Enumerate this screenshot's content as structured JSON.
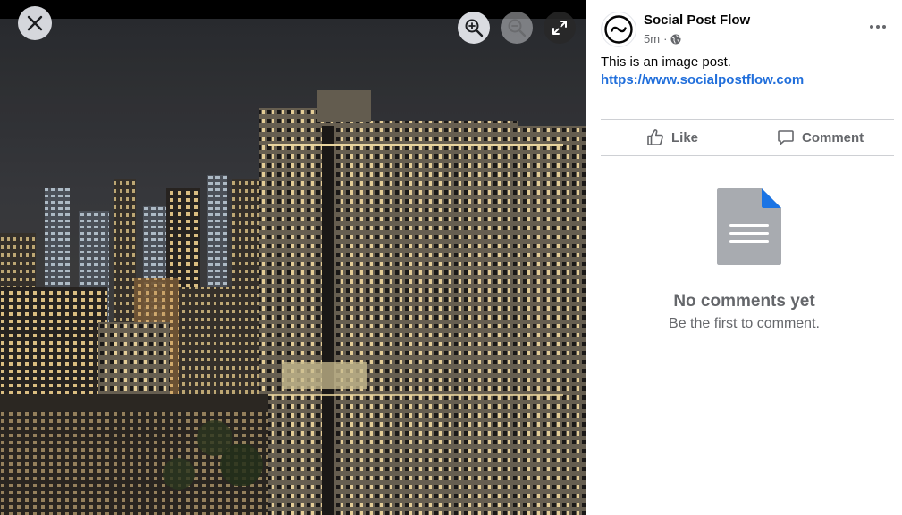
{
  "viewer": {
    "close_icon": "close-icon",
    "zoom_in_icon": "zoom-in-icon",
    "zoom_out_icon": "zoom-out-icon",
    "fullscreen_icon": "expand-icon"
  },
  "post": {
    "author": "Social Post Flow",
    "time": "5m",
    "separator": "·",
    "privacy_icon": "globe-icon",
    "text": "This is an image post.",
    "link": "https://www.socialpostflow.com"
  },
  "actions": {
    "like_label": "Like",
    "comment_label": "Comment"
  },
  "comments": {
    "empty_title": "No comments yet",
    "empty_subtitle": "Be the first to comment."
  },
  "colors": {
    "link": "#216fdb",
    "muted_text": "#65676b",
    "doc_icon_gray": "#a8abb0",
    "doc_icon_fold": "#1b74e4"
  }
}
